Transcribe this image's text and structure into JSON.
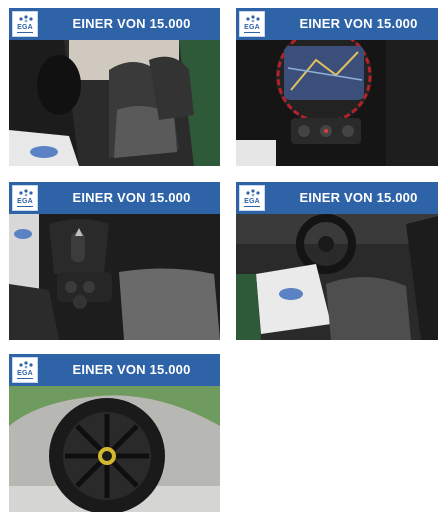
{
  "gallery": {
    "banner_text": "EINER VON 15.000",
    "badge_text": "EGA",
    "photos": [
      {
        "subject": "front seats interior"
      },
      {
        "subject": "infotainment navigation display"
      },
      {
        "subject": "gear selector and center console"
      },
      {
        "subject": "steering wheel and dashboard"
      },
      {
        "subject": "alloy wheel"
      }
    ]
  },
  "colors": {
    "banner": "#2f63a8",
    "badge_bg": "#ffffff",
    "text": "#ffffff",
    "car_green": "#2e5a3a"
  },
  "icons": [
    "ega-logo-icon"
  ]
}
